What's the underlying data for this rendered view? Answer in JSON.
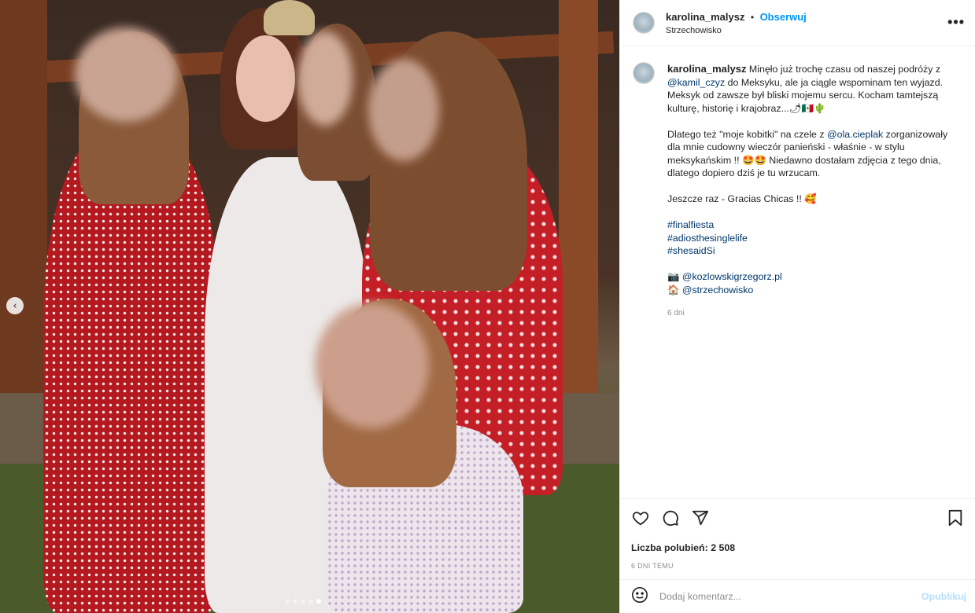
{
  "post": {
    "author": "karolina_malysz",
    "follow_label": "Obserwuj",
    "separator": "•",
    "location": "Strzechowisko",
    "more_label": "•••"
  },
  "caption": {
    "author": "karolina_malysz",
    "p1_a": "Minęło już trochę czasu od naszej podróży z",
    "p1_mention": "@kamil_czyz",
    "p1_b": "do Meksyku, ale ja ciągle wspominam ten wyjazd. Meksyk od zawsze był bliski mojemu sercu. Kocham tamtejszą kulturę, historię i krajobraz...🌶🇲🇽🌵",
    "p2_a": "Dlatego też \"moje kobitki\" na czele z",
    "p2_mention": "@ola.cieplak",
    "p2_b": "zorganizowały dla mnie cudowny wieczór panieński - właśnie - w stylu meksykańskim !! 🤩🤩 Niedawno dostałam zdjęcia z tego dnia, dlatego dopiero dziś je tu wrzucam.",
    "p3": "Jeszcze raz - Gracias Chicas !! 🥰",
    "hashtags": [
      "#finalfiesta",
      "#adiosthesinglelife",
      "#shesaidSi"
    ],
    "credit1_icon": "📷",
    "credit1": "@kozlowskigrzegorz.pl",
    "credit2_icon": "🏠",
    "credit2": "@strzechowisko",
    "time_ago": "6 dni"
  },
  "actions": {
    "likes": "Liczba polubień: 2 508",
    "date": "6 DNI TEMU"
  },
  "comment": {
    "placeholder": "Dodaj komentarz...",
    "post_label": "Opublikuj"
  },
  "carousel": {
    "prev_icon": "‹",
    "dots": 5,
    "active_index": 4
  },
  "icons": [
    "chevron-left-icon",
    "heart-icon",
    "comment-icon",
    "share-icon",
    "bookmark-icon",
    "emoji-icon"
  ]
}
